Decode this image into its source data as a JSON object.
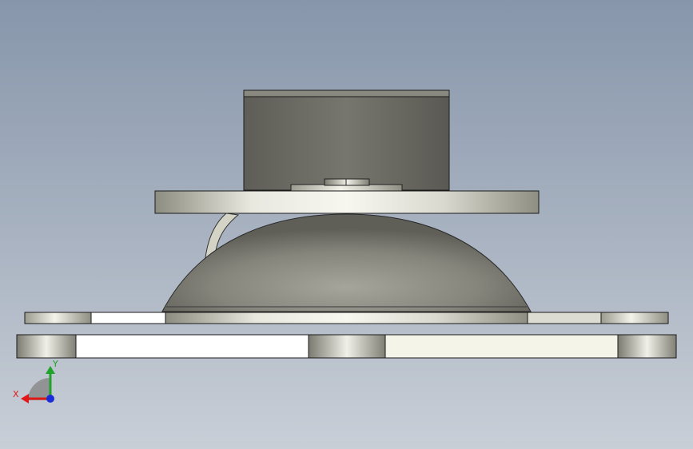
{
  "viewport": {
    "background_top": "#8796ab",
    "background_bottom": "#c9cfd7"
  },
  "triad": {
    "x_label": "X",
    "y_label": "Y",
    "x_color": "#e01818",
    "y_color": "#1fa32a",
    "z_color": "#1a2bd8"
  },
  "icons": {
    "triad": "view-orientation-triad-icon"
  }
}
